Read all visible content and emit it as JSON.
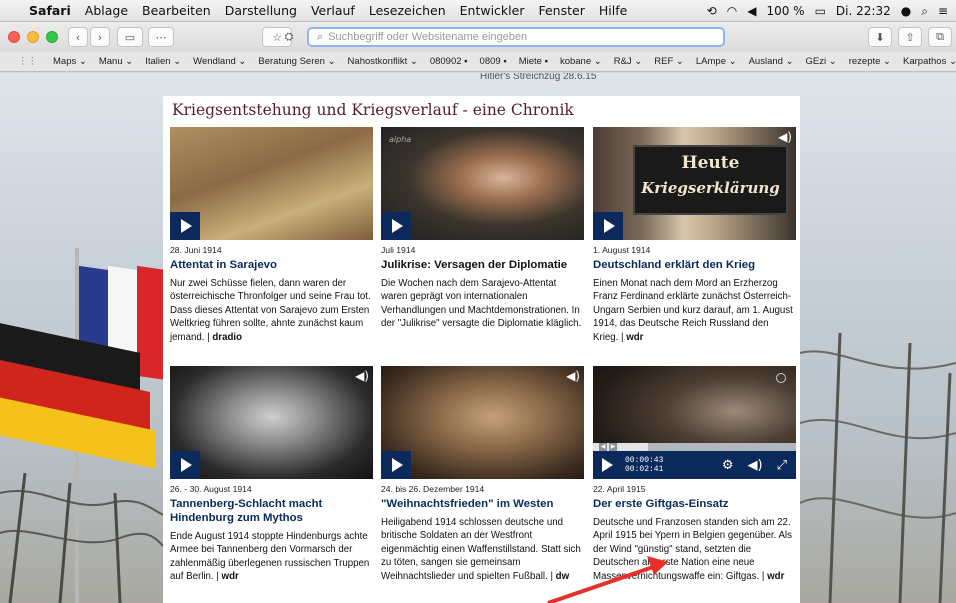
{
  "menubar": {
    "app": "Safari",
    "items": [
      "Ablage",
      "Bearbeiten",
      "Darstellung",
      "Verlauf",
      "Lesezeichen",
      "Entwickler",
      "Fenster",
      "Hilfe"
    ],
    "battery": "100 %",
    "clock": "Di. 22:32"
  },
  "toolbar": {
    "url_placeholder": "Suchbegriff oder Websitename eingeben"
  },
  "bookmarks": [
    "Maps ⌄",
    "Manu ⌄",
    "Italien ⌄",
    "Wendland ⌄",
    "Beratung Seren ⌄",
    "Nahostkonflikt ⌄",
    "080902 ▪",
    "0809 ▪",
    "Miete ▪",
    "kobane ⌄",
    "R&J ⌄",
    "REF ⌄",
    "LAmpe ⌄",
    "Ausland ⌄",
    "GEzi ⌄",
    "rezepte ⌄",
    "Karpathos ⌄",
    "»"
  ],
  "peek_text": "Hitler's Streichzug 28.6.15",
  "page": {
    "title": "Kriegsentstehung und Kriegsverlauf - eine Chronik"
  },
  "cards": [
    {
      "date": "28. Juni 1914",
      "title": "Attentat in Sarajevo",
      "desc": "Nur zwei Schüsse fielen, dann waren der österreichische Thronfolger und seine Frau tot. Dass dieses Attentat von Sarajevo zum Ersten Weltkrieg führen sollte, ahnte zunächst kaum jemand. |",
      "source": "dradio"
    },
    {
      "date": "Juli 1914",
      "title": "Julikrise: Versagen der Diplomatie",
      "desc": "Die Wochen nach dem Sarajevo-Attentat waren geprägt von internationalen Verhandlungen und Machtdemonstrationen. In der \"Julikrise\" versagte die Diplomatie kläglich.",
      "source": "",
      "watermark": "alpha"
    },
    {
      "date": "1. August 1914",
      "title": "Deutschland erklärt den Krieg",
      "desc": "Einen Monat nach dem Mord an Erzherzog Franz Ferdinand erklärte zunächst Österreich-Ungarn Serbien und kurz darauf, am 1. August 1914, das Deutsche Reich Russland den Krieg. |",
      "source": "wdr",
      "sign_line1": "Heute",
      "sign_line2": "Kriegserklärung"
    },
    {
      "date": "26. - 30. August 1914",
      "title": "Tannenberg-Schlacht macht Hindenburg zum Mythos",
      "desc": "Ende August 1914 stoppte Hindenburgs achte Armee bei Tannenberg den Vormarsch der zahlenmäßig überlegenen russischen Truppen auf Berlin. |",
      "source": "wdr"
    },
    {
      "date": "24. bis 26. Dezember 1914",
      "title": "\"Weihnachtsfrieden\" im Westen",
      "desc": "Heiligabend 1914 schlossen deutsche und britische Soldaten an der Westfront eigenmächtig einen Waffenstillstand. Statt sich zu töten, sangen sie gemeinsam Weihnachtslieder und spielten Fußball. |",
      "source": "dw"
    },
    {
      "date": "22. April 1915",
      "title": "Der erste Giftgas-Einsatz",
      "desc": "Deutsche und Franzosen standen sich am 22. April 1915 bei Ypern in Belgien gegenüber. Als der Wind \"günstig\" stand, setzten die Deutschen als erste Nation eine neue Massenvernichtungswaffe ein: Giftgas. |",
      "source": "wdr",
      "video": {
        "current": "00:00:43",
        "total": "00:02:41",
        "progress": 0.27
      }
    }
  ],
  "colors": {
    "accent": "#0b2a5b",
    "title": "#5a1a33",
    "arrow": "#e8302a"
  },
  "icons": [
    "apple-icon",
    "play-icon",
    "audio-icon",
    "settings-icon",
    "fullscreen-icon",
    "search-icon",
    "share-icon",
    "sidebar-icon",
    "grid-icon"
  ]
}
